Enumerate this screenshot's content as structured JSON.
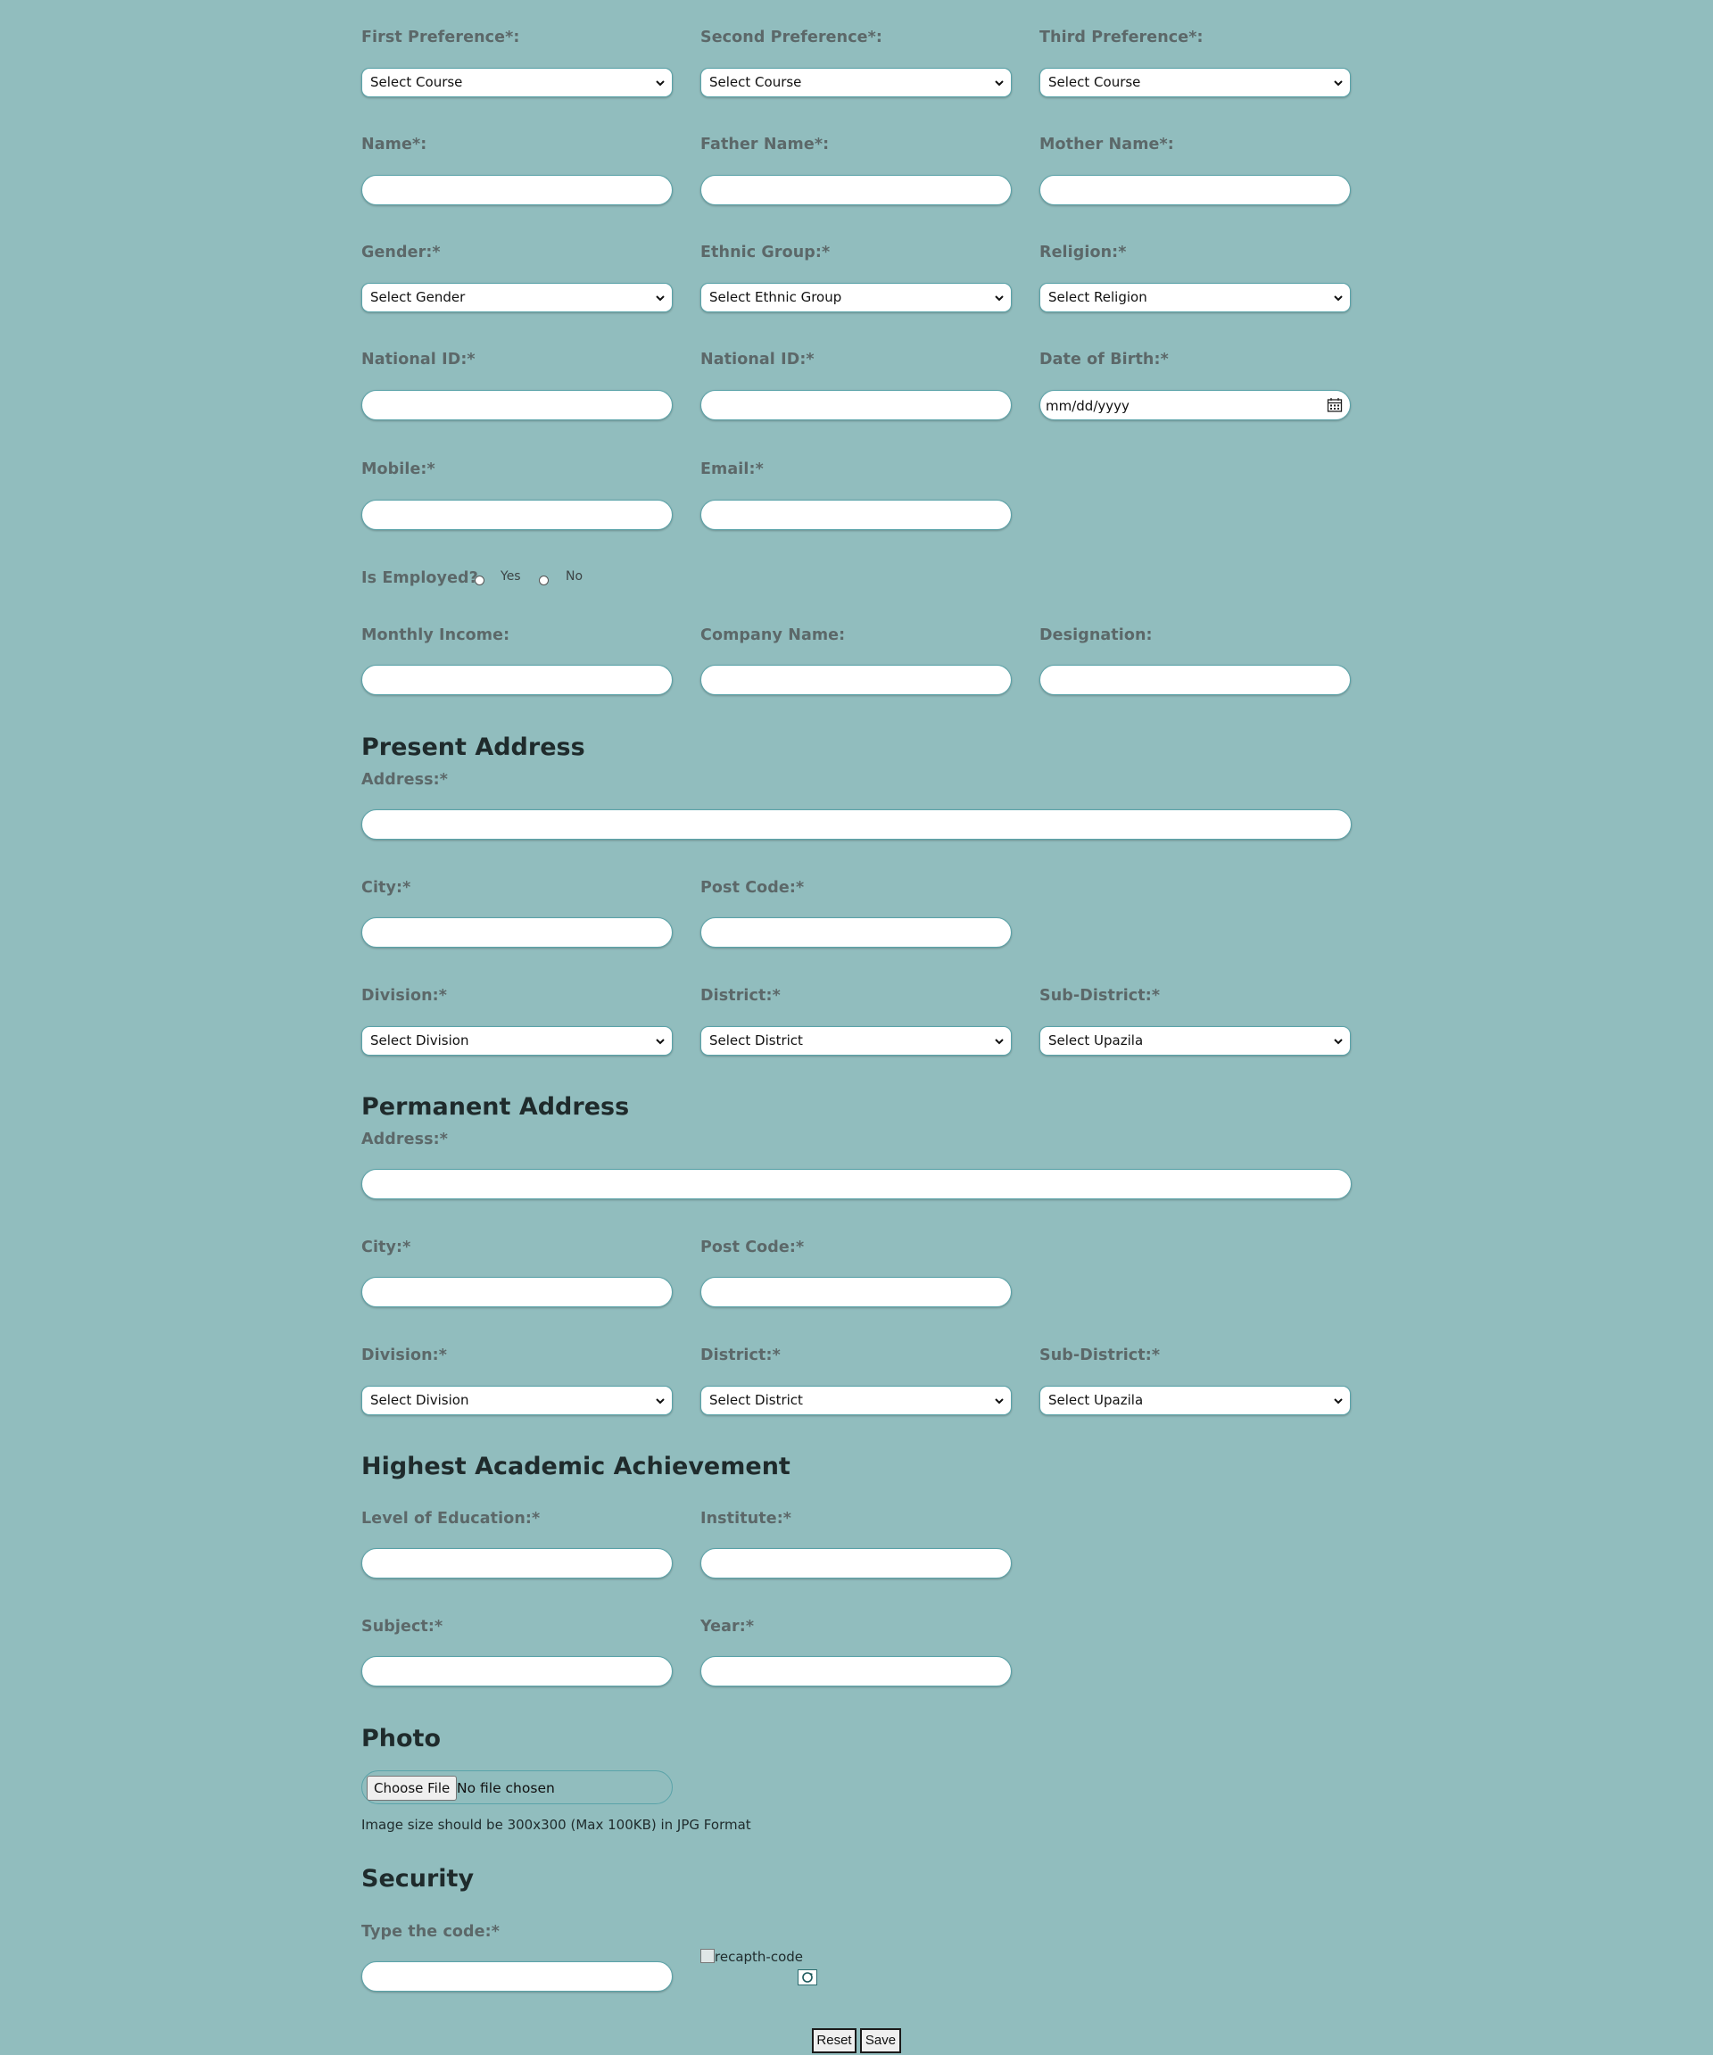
{
  "preferences": {
    "first_label": "First Preference*:",
    "second_label": "Second Preference*:",
    "third_label": "Third Preference*:",
    "select_course": "Select Course"
  },
  "personal": {
    "name_label": "Name*:",
    "father_label": "Father Name*:",
    "mother_label": "Mother Name*:",
    "gender_label": "Gender:*",
    "gender_value": "Select Gender",
    "ethnic_label": "Ethnic Group:*",
    "ethnic_value": "Select Ethnic Group",
    "religion_label": "Religion:*",
    "religion_value": "Select Religion",
    "nid_label": "National ID:*",
    "nid2_label": "National ID:*",
    "dob_label": "Date of Birth:*",
    "dob_placeholder": "mm/dd/yyyy",
    "mobile_label": "Mobile:*",
    "email_label": "Email:*"
  },
  "employment": {
    "question": "Is Employed?",
    "yes": "Yes",
    "no": "No",
    "income_label": "Monthly Income:",
    "company_label": "Company Name:",
    "designation_label": "Designation:"
  },
  "present_address": {
    "heading": "Present Address",
    "address_label": "Address:*",
    "city_label": "City:*",
    "postcode_label": "Post Code:*",
    "division_label": "Division:*",
    "district_label": "District:*",
    "subdistrict_label": "Sub-District:*",
    "division_value": "Select Division",
    "district_value": "Select District",
    "upazila_value": "Select Upazila"
  },
  "permanent_address": {
    "heading": "Permanent Address",
    "address_label": "Address:*",
    "city_label": "City:*",
    "postcode_label": "Post Code:*",
    "division_label": "Division:*",
    "district_label": "District:*",
    "subdistrict_label": "Sub-District:*",
    "division_value": "Select Division",
    "district_value": "Select District",
    "upazila_value": "Select Upazila"
  },
  "academic": {
    "heading": "Highest Academic Achievement",
    "level_label": "Level of Education:*",
    "institute_label": "Institute:*",
    "subject_label": "Subject:*",
    "year_label": "Year:*"
  },
  "photo": {
    "heading": "Photo",
    "choose_label": "Choose File",
    "no_file": "No file chosen",
    "hint": "Image size should be 300x300 (Max 100KB) in JPG Format"
  },
  "security": {
    "heading": "Security",
    "code_label": "Type the code:*",
    "captcha_alt": "recapth-code"
  },
  "actions": {
    "reset": "Reset",
    "save": "Save"
  }
}
